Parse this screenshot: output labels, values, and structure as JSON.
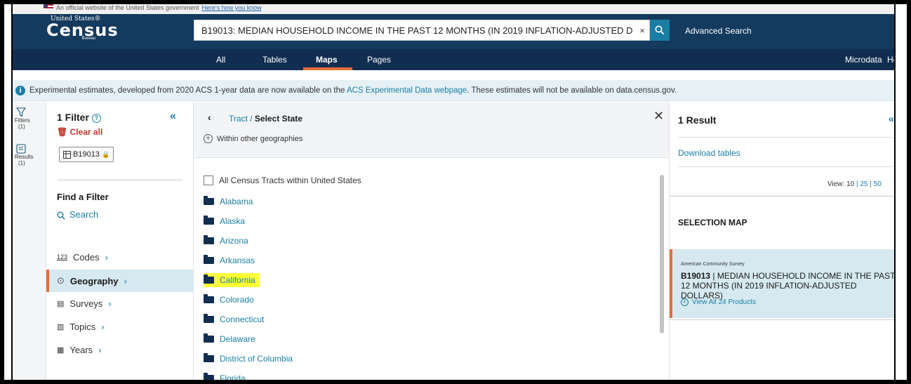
{
  "gov_banner": {
    "text": "An official website of the United States government",
    "link": "Here's how you know"
  },
  "logo": {
    "line1": "United States®",
    "line2": "Census",
    "line3": "Bureau"
  },
  "search": {
    "value": "B19013: MEDIAN HOUSEHOLD INCOME IN THE PAST 12 MONTHS (IN 2019 INFLATION-ADJUSTED D",
    "clear_icon": "×",
    "advanced": "Advanced Search"
  },
  "nav": {
    "tabs": [
      "All",
      "Tables",
      "Maps",
      "Pages"
    ],
    "active": "Maps",
    "microdata": "Microdata",
    "help": "He"
  },
  "info": {
    "text_before": "Experimental estimates, developed from 2020 ACS 1-year data are now available on the ",
    "link": "ACS Experimental Data webpage",
    "text_after": ". These estimates will not be available on data.census.gov."
  },
  "rail": {
    "filters_label": "Filters",
    "filters_count": "(1)",
    "results_label": "Results",
    "results_count": "(1)"
  },
  "filter_panel": {
    "title": "1 Filter",
    "clear_all": "Clear all",
    "chip_label": "B19013",
    "find_a_filter": "Find a Filter",
    "search_label": "Search",
    "items": [
      {
        "label": "Codes",
        "icon": "codes-icon"
      },
      {
        "label": "Geography",
        "icon": "location-pin-icon"
      },
      {
        "label": "Surveys",
        "icon": "clipboard-icon"
      },
      {
        "label": "Topics",
        "icon": "book-icon"
      },
      {
        "label": "Years",
        "icon": "calendar-icon"
      }
    ],
    "active_item": "Geography"
  },
  "geo_panel": {
    "crumb_link": "Tract",
    "crumb_sep": " / ",
    "crumb_current": "Select State",
    "within": "Within other geographies",
    "all_label": "All Census Tracts within United States",
    "states": [
      "Alabama",
      "Alaska",
      "Arizona",
      "Arkansas",
      "California",
      "Colorado",
      "Connecticut",
      "Delaware",
      "District of Columbia",
      "Florida"
    ],
    "highlighted": "California"
  },
  "results": {
    "title": "1 Result",
    "download": "Download tables",
    "view_label": "View:",
    "view_options": [
      "10",
      "25",
      "50"
    ],
    "selection_map": "SELECTION MAP",
    "card": {
      "source": "American Community Survey",
      "code": "B19013",
      "sep": " | ",
      "title": "MEDIAN HOUSEHOLD INCOME IN THE PAST 12 MONTHS (IN 2019 INFLATION-ADJUSTED DOLLARS)",
      "view_all": "View All 24 Products"
    }
  }
}
